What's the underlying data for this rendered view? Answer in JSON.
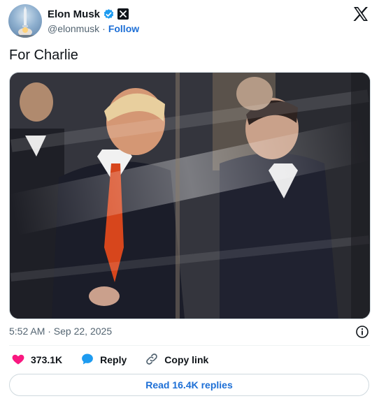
{
  "author": {
    "display_name": "Elon Musk",
    "handle": "@elonmusk",
    "separator": "·",
    "follow_label": "Follow",
    "verified_badge": "verified-check-icon",
    "affiliate_badge": "x-badge-icon"
  },
  "post": {
    "text": "For Charlie",
    "timestamp": "5:52 AM · Sep 22, 2025"
  },
  "actions": {
    "likes_count": "373.1K",
    "reply_label": "Reply",
    "copy_link_label": "Copy link",
    "read_replies_label": "Read 16.4K replies"
  },
  "colors": {
    "accent": "#1d6fd6",
    "heart": "#f91880",
    "verified": "#1d9bf0",
    "muted_text": "#536471"
  }
}
